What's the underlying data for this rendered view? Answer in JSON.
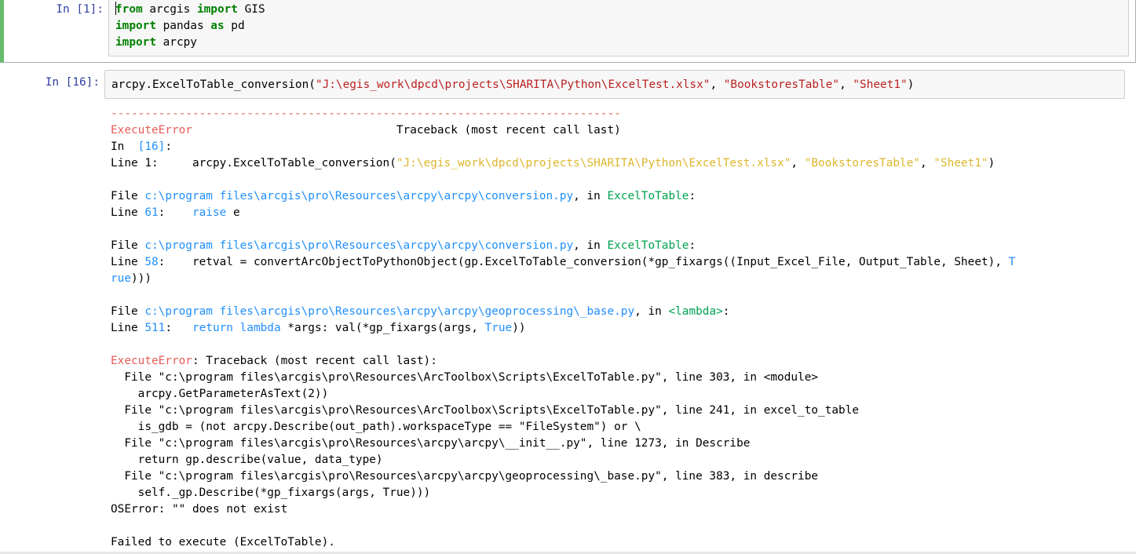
{
  "cell1": {
    "prompt": "In [1]:",
    "lines": [
      [
        {
          "t": "from",
          "c": "kw"
        },
        {
          "t": " arcgis "
        },
        {
          "t": "import",
          "c": "kw"
        },
        {
          "t": " GIS"
        }
      ],
      [
        {
          "t": "import",
          "c": "kw"
        },
        {
          "t": " pandas "
        },
        {
          "t": "as",
          "c": "kw"
        },
        {
          "t": " pd"
        }
      ],
      [
        {
          "t": "import",
          "c": "kw"
        },
        {
          "t": " arcpy"
        }
      ]
    ]
  },
  "cell2": {
    "prompt": "In [16]:",
    "code": [
      {
        "t": "arcpy.ExcelToTable_conversion("
      },
      {
        "t": "\"J:\\egis_work\\dpcd\\projects\\SHARITA\\Python\\ExcelTest.xlsx\"",
        "c": "str"
      },
      {
        "t": ", "
      },
      {
        "t": "\"BookstoresTable\"",
        "c": "str"
      },
      {
        "t": ", "
      },
      {
        "t": "\"Sheet1\"",
        "c": "str"
      },
      {
        "t": ")"
      }
    ],
    "output": [
      [
        {
          "t": "---------------------------------------------------------------------------",
          "c": "red"
        }
      ],
      [
        {
          "t": "ExecuteError",
          "c": "red"
        },
        {
          "t": "                              Traceback (most recent call last)"
        }
      ],
      [
        {
          "t": "In  "
        },
        {
          "t": "[16]",
          "c": "cyan"
        },
        {
          "t": ":"
        }
      ],
      [
        {
          "t": "Line 1:     arcpy.ExcelToTable_conversion("
        },
        {
          "t": "\"J:\\egis_work\\dpcd\\projects\\SHARITA\\Python\\ExcelTest.xlsx\"",
          "c": "yellow"
        },
        {
          "t": ", "
        },
        {
          "t": "\"BookstoresTable\"",
          "c": "yellow"
        },
        {
          "t": ", "
        },
        {
          "t": "\"Sheet1\"",
          "c": "yellow"
        },
        {
          "t": ")"
        }
      ],
      [
        {
          "t": ""
        }
      ],
      [
        {
          "t": "File "
        },
        {
          "t": "c:\\program files\\arcgis\\pro\\Resources\\arcpy\\arcpy\\conversion.py",
          "c": "cyan"
        },
        {
          "t": ", in "
        },
        {
          "t": "ExcelToTable",
          "c": "green"
        },
        {
          "t": ":"
        }
      ],
      [
        {
          "t": "Line "
        },
        {
          "t": "61",
          "c": "cyan"
        },
        {
          "t": ":    "
        },
        {
          "t": "raise",
          "c": "cyan"
        },
        {
          "t": " e"
        }
      ],
      [
        {
          "t": ""
        }
      ],
      [
        {
          "t": "File "
        },
        {
          "t": "c:\\program files\\arcgis\\pro\\Resources\\arcpy\\arcpy\\conversion.py",
          "c": "cyan"
        },
        {
          "t": ", in "
        },
        {
          "t": "ExcelToTable",
          "c": "green"
        },
        {
          "t": ":"
        }
      ],
      [
        {
          "t": "Line "
        },
        {
          "t": "58",
          "c": "cyan"
        },
        {
          "t": ":    retval = convertArcObjectToPythonObject(gp.ExcelToTable_conversion(*gp_fixargs((Input_Excel_File, Output_Table, Sheet), "
        },
        {
          "t": "T",
          "c": "cyan"
        }
      ],
      [
        {
          "t": "rue",
          "c": "cyan"
        },
        {
          "t": ")))"
        }
      ],
      [
        {
          "t": ""
        }
      ],
      [
        {
          "t": "File "
        },
        {
          "t": "c:\\program files\\arcgis\\pro\\Resources\\arcpy\\arcpy\\geoprocessing\\_base.py",
          "c": "cyan"
        },
        {
          "t": ", in "
        },
        {
          "t": "<lambda>",
          "c": "green"
        },
        {
          "t": ":"
        }
      ],
      [
        {
          "t": "Line "
        },
        {
          "t": "511",
          "c": "cyan"
        },
        {
          "t": ":   "
        },
        {
          "t": "return",
          "c": "cyan"
        },
        {
          "t": " "
        },
        {
          "t": "lambda",
          "c": "cyan"
        },
        {
          "t": " *args: val(*gp_fixargs(args, "
        },
        {
          "t": "True",
          "c": "cyan"
        },
        {
          "t": "))"
        }
      ],
      [
        {
          "t": ""
        }
      ],
      [
        {
          "t": "ExecuteError",
          "c": "red"
        },
        {
          "t": ": Traceback (most recent call last):"
        }
      ],
      [
        {
          "t": "  File \"c:\\program files\\arcgis\\pro\\Resources\\ArcToolbox\\Scripts\\ExcelToTable.py\", line 303, in <module>"
        }
      ],
      [
        {
          "t": "    arcpy.GetParameterAsText(2))"
        }
      ],
      [
        {
          "t": "  File \"c:\\program files\\arcgis\\pro\\Resources\\ArcToolbox\\Scripts\\ExcelToTable.py\", line 241, in excel_to_table"
        }
      ],
      [
        {
          "t": "    is_gdb = (not arcpy.Describe(out_path).workspaceType == \"FileSystem\") or \\"
        }
      ],
      [
        {
          "t": "  File \"c:\\program files\\arcgis\\pro\\Resources\\arcpy\\arcpy\\__init__.py\", line 1273, in Describe"
        }
      ],
      [
        {
          "t": "    return gp.describe(value, data_type)"
        }
      ],
      [
        {
          "t": "  File \"c:\\program files\\arcgis\\pro\\Resources\\arcpy\\arcpy\\geoprocessing\\_base.py\", line 383, in describe"
        }
      ],
      [
        {
          "t": "    self._gp.Describe(*gp_fixargs(args, True)))"
        }
      ],
      [
        {
          "t": "OSError: \"\" does not exist"
        }
      ],
      [
        {
          "t": ""
        }
      ],
      [
        {
          "t": "Failed to execute (ExcelToTable)."
        }
      ]
    ]
  }
}
